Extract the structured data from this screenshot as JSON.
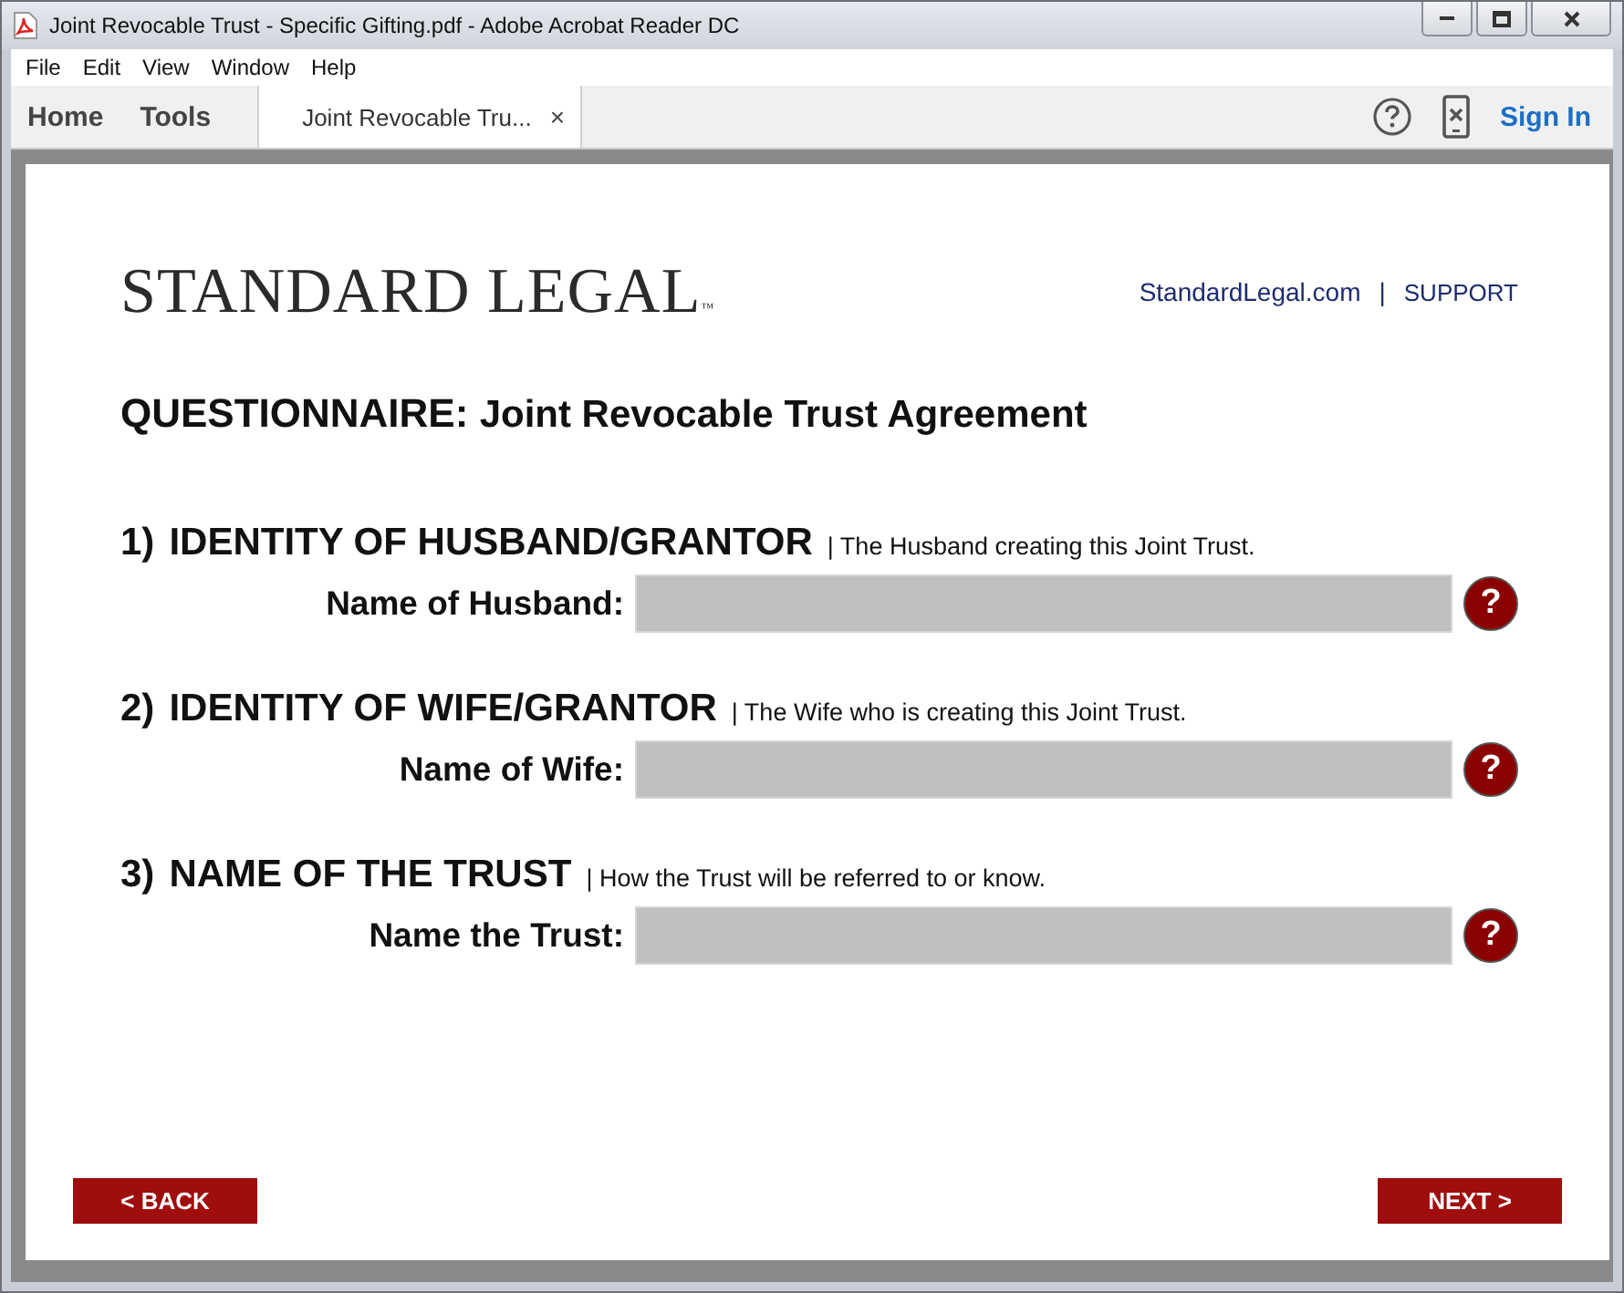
{
  "window": {
    "title": "Joint Revocable Trust - Specific Gifting.pdf - Adobe Acrobat Reader DC"
  },
  "menu": [
    "File",
    "Edit",
    "View",
    "Window",
    "Help"
  ],
  "toolbar": {
    "nav": [
      "Home",
      "Tools"
    ],
    "tabs": [
      {
        "label": "Joint Revocable Tru...",
        "close": "×",
        "selected": true
      }
    ],
    "sign_in": "Sign In"
  },
  "document": {
    "logo": "STANDARD LEGAL",
    "trademark": "™",
    "links": [
      "StandardLegal.com",
      "SUPPORT"
    ],
    "link_separator": "|",
    "title_lead": "QUESTIONNAIRE:",
    "title_rest": "Joint Revocable Trust Agreement",
    "sections": [
      {
        "number": "1)",
        "heading": "IDENTITY OF HUSBAND/GRANTOR",
        "description": "| The Husband creating this Joint Trust.",
        "label": "Name of Husband:",
        "help": "?"
      },
      {
        "number": "2)",
        "heading": "IDENTITY OF WIFE/GRANTOR",
        "description": "| The Wife who is creating this Joint Trust.",
        "label": "Name of Wife:",
        "help": "?"
      },
      {
        "number": "3)",
        "heading": "NAME OF THE TRUST",
        "description": "| How the Trust will be referred to or know.",
        "label": "Name the Trust:",
        "help": "?"
      }
    ],
    "buttons": [
      "< BACK",
      "NEXT >"
    ]
  }
}
